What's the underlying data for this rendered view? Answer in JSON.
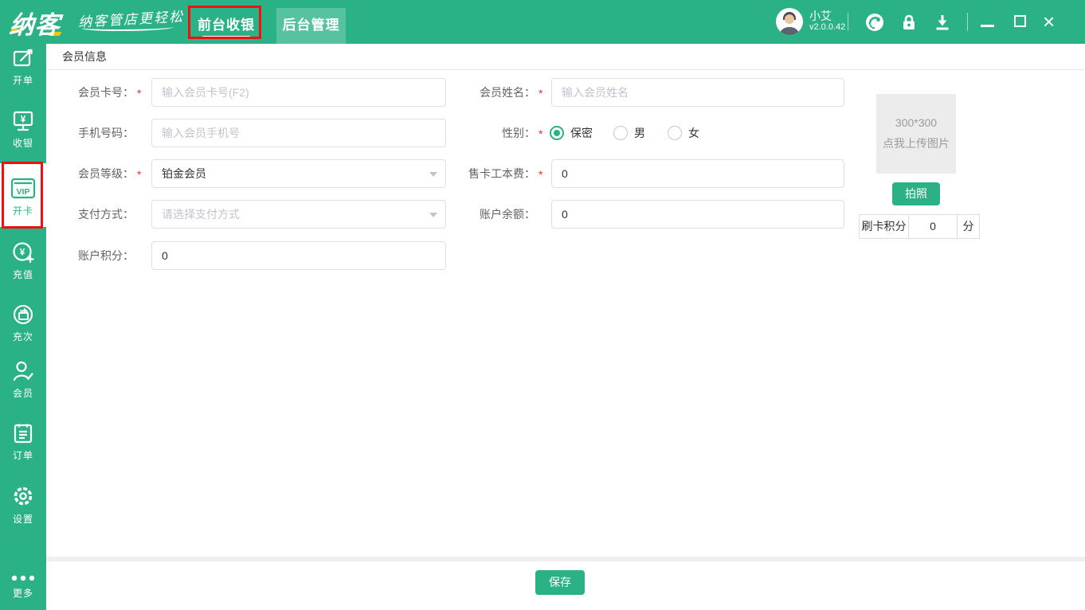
{
  "colors": {
    "primary_green": "#2bb186",
    "tab_inactive_green": "#57c29f",
    "annotation_red": "#ee1111"
  },
  "header": {
    "logo": "纳客",
    "tagline": "纳客管店更轻松",
    "tabs": [
      {
        "label": "前台收银",
        "active": true
      },
      {
        "label": "后台管理",
        "active": false
      }
    ],
    "user": {
      "name": "小艾",
      "version": "v2.0.0.42"
    },
    "window_controls": {
      "close": "×"
    }
  },
  "sidebar": {
    "items": [
      {
        "label": "开单"
      },
      {
        "label": "收银"
      },
      {
        "label": "开卡",
        "badge": "VIP",
        "active": true
      },
      {
        "label": "充值"
      },
      {
        "label": "充次"
      },
      {
        "label": "会员"
      },
      {
        "label": "订单"
      },
      {
        "label": "设置"
      }
    ],
    "more_label": "更多"
  },
  "page": {
    "title": "会员信息"
  },
  "form": {
    "card_number": {
      "label": "会员卡号：",
      "required": "*",
      "placeholder": "输入会员卡号(F2)"
    },
    "member_name": {
      "label": "会员姓名：",
      "required": "*",
      "placeholder": "输入会员姓名"
    },
    "phone": {
      "label": "手机号码：",
      "placeholder": "输入会员手机号"
    },
    "gender": {
      "label": "性别：",
      "required": "*",
      "options": [
        "保密",
        "男",
        "女"
      ],
      "selected": "保密"
    },
    "level": {
      "label": "会员等级：",
      "required": "*",
      "value": "铂金会员"
    },
    "card_fee": {
      "label": "售卡工本费：",
      "required": "*",
      "value": "0"
    },
    "payment": {
      "label": "支付方式：",
      "placeholder": "请选择支付方式"
    },
    "balance": {
      "label": "账户余额：",
      "value": "0"
    },
    "points": {
      "label": "账户积分：",
      "value": "0"
    }
  },
  "photo_panel": {
    "size_hint": "300*300",
    "upload_hint": "点我上传图片",
    "take_photo": "拍照",
    "swipe_points": {
      "label": "刷卡积分",
      "value": "0",
      "unit": "分"
    }
  },
  "footer": {
    "save": "保存"
  }
}
